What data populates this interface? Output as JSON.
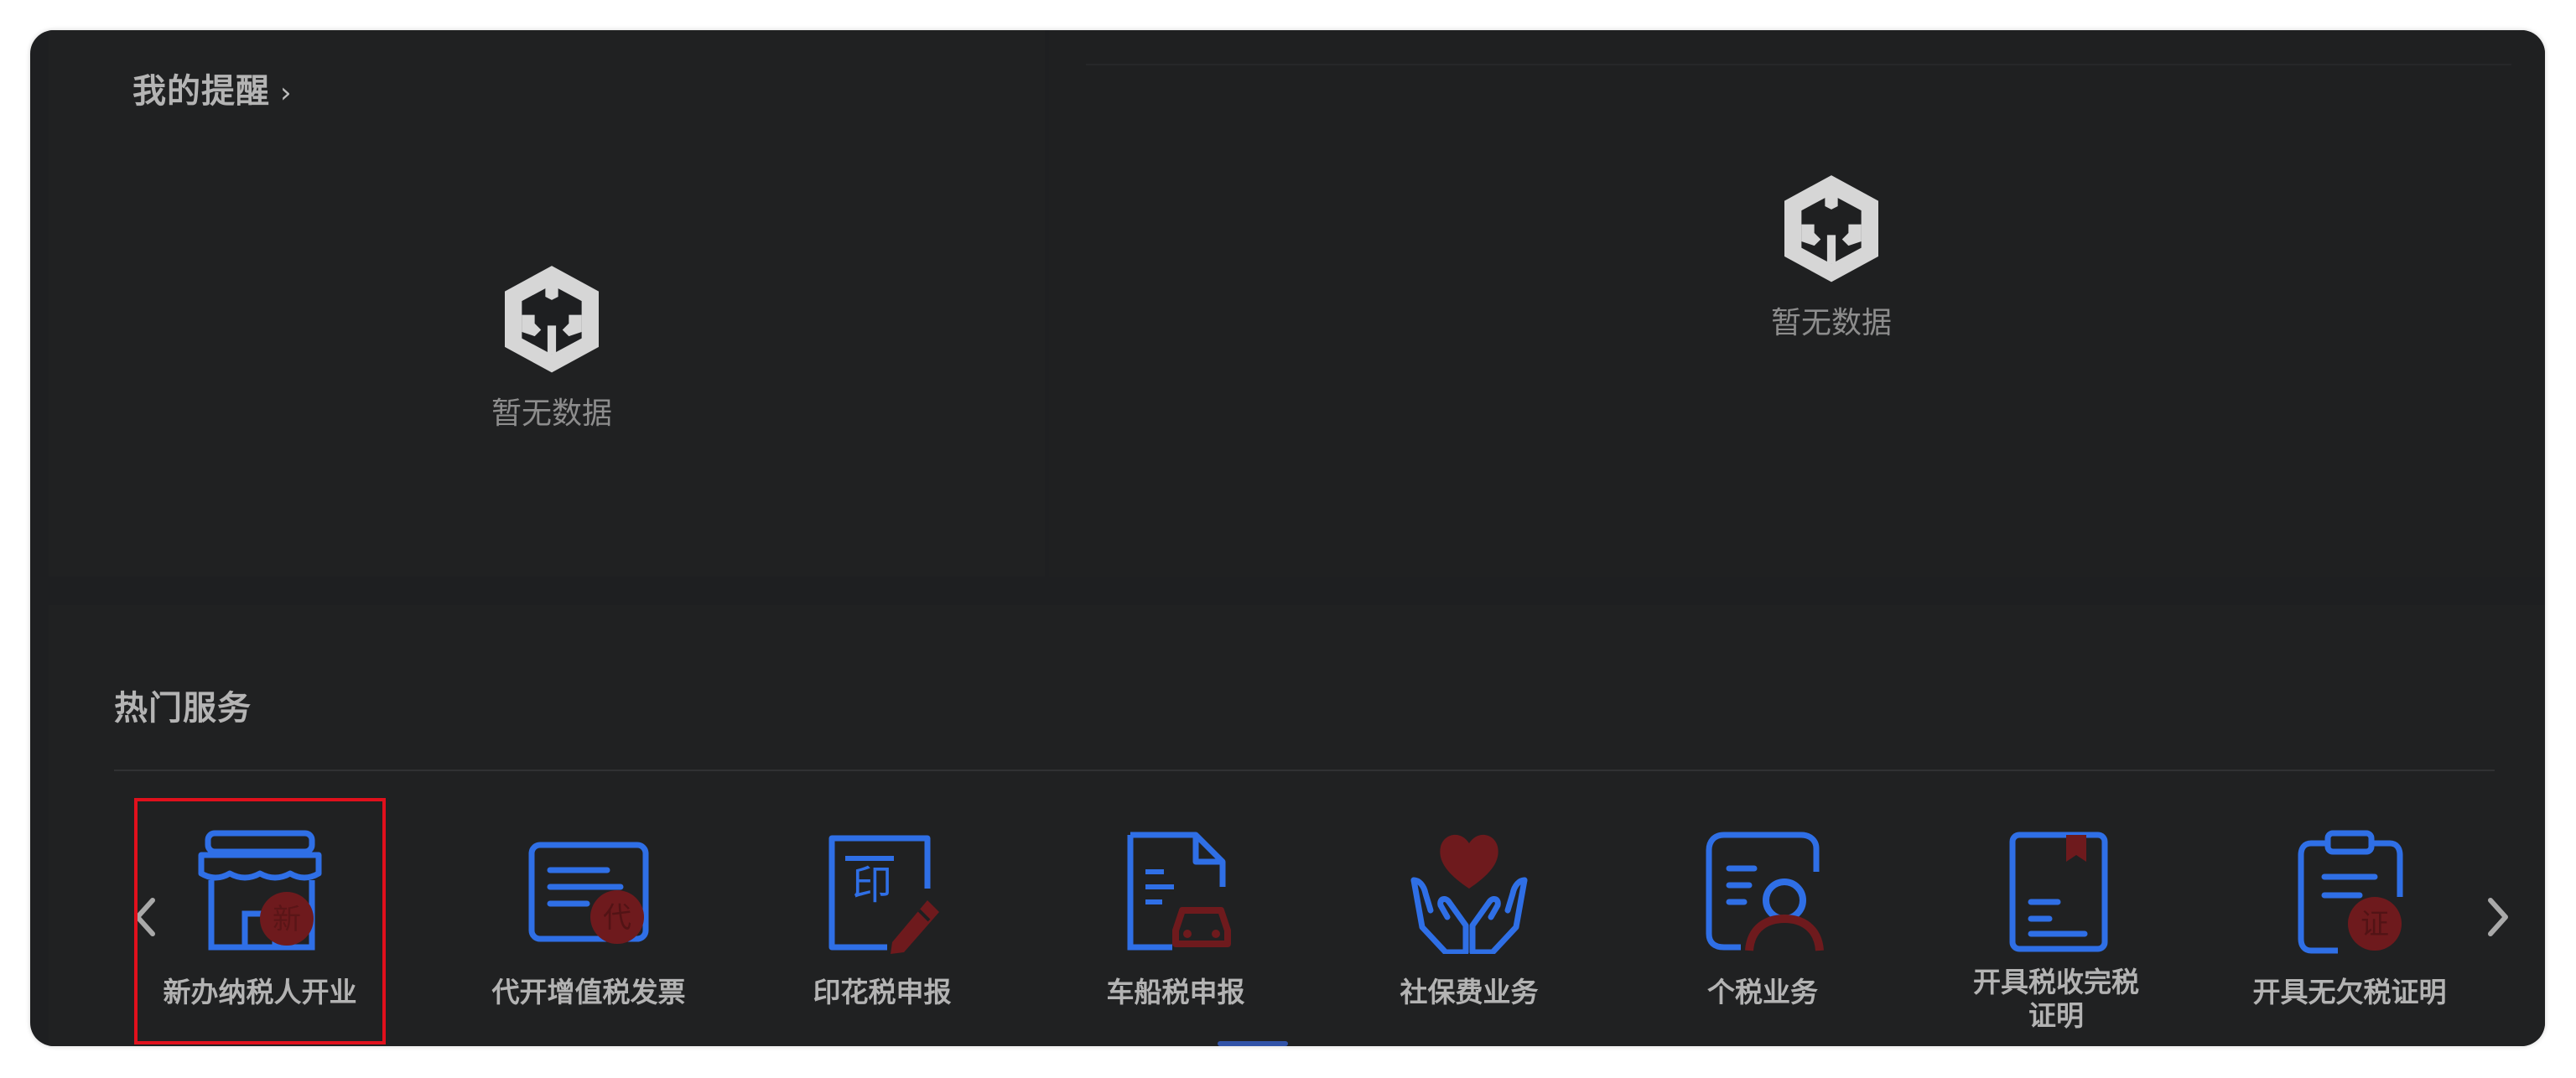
{
  "reminders": {
    "title": "我的提醒",
    "chevron": "›",
    "empty_left_text": "暂无数据",
    "empty_right_text": "暂无数据",
    "empty_icon": "empty-box-icon"
  },
  "hot_services": {
    "title": "热门服务",
    "prev_icon": "chevron-left-icon",
    "next_icon": "chevron-right-icon",
    "items": [
      {
        "label": "新办纳税人开业",
        "icon": "storefront-icon",
        "badge": "新",
        "selected": true
      },
      {
        "label": "代开增值税发票",
        "icon": "invoice-card-icon",
        "badge": "代"
      },
      {
        "label": "印花税申报",
        "icon": "stamp-document-icon",
        "badge": "印"
      },
      {
        "label": "车船税申报",
        "icon": "vehicle-document-icon"
      },
      {
        "label": "社保费业务",
        "icon": "heart-hands-icon"
      },
      {
        "label": "个税业务",
        "icon": "person-document-icon"
      },
      {
        "label": "开具税收完税证明",
        "icon": "bookmark-document-icon"
      },
      {
        "label": "开具无欠税证明",
        "icon": "clipboard-certificate-icon",
        "badge": "证"
      }
    ]
  },
  "colors": {
    "card_bg": "#1e1f21",
    "icon_blue": "#2f6fe6",
    "icon_accent": "#6e1a1d",
    "selection": "#e0101c"
  }
}
